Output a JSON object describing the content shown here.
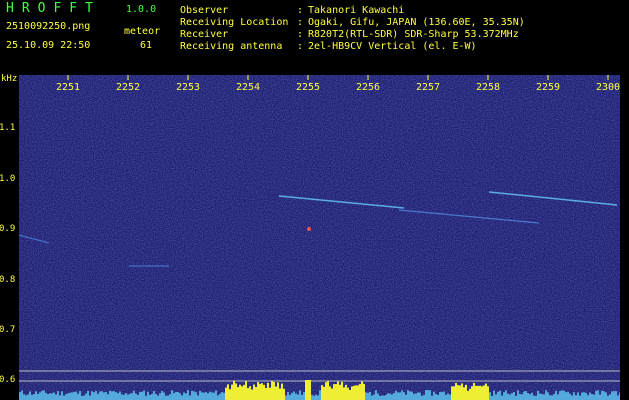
{
  "header": {
    "app_title": "HROFFT",
    "version": "1.0.0",
    "filename": "2510092250.png",
    "meteor_label": "meteor",
    "datetime": "25.10.09 22:50",
    "meteor_count": "61",
    "info": [
      {
        "label": "Observer",
        "value": "Takanori Kawachi"
      },
      {
        "label": "Receiving Location",
        "value": "Ogaki, Gifu, JAPAN (136.60E, 35.35N)"
      },
      {
        "label": "Receiver",
        "value": "R820T2(RTL-SDR) SDR-Sharp 53.372MHz"
      },
      {
        "label": "Receiving antenna",
        "value": "2el-HB9CV Vertical (el. E-W)"
      }
    ]
  },
  "axis": {
    "y_unit": "kHz",
    "y_ticks": [
      "1.1",
      "1.0",
      "0.9",
      "0.8",
      "0.7",
      "0.6"
    ],
    "x_ticks": [
      "2251",
      "2252",
      "2253",
      "2254",
      "2255",
      "2256",
      "2257",
      "2258",
      "2259",
      "2300"
    ]
  },
  "colors": {
    "text_yellow": "#ffff40",
    "text_green": "#40ff40",
    "background": "#000000",
    "spectrum_bg": "#1a1a6e"
  }
}
